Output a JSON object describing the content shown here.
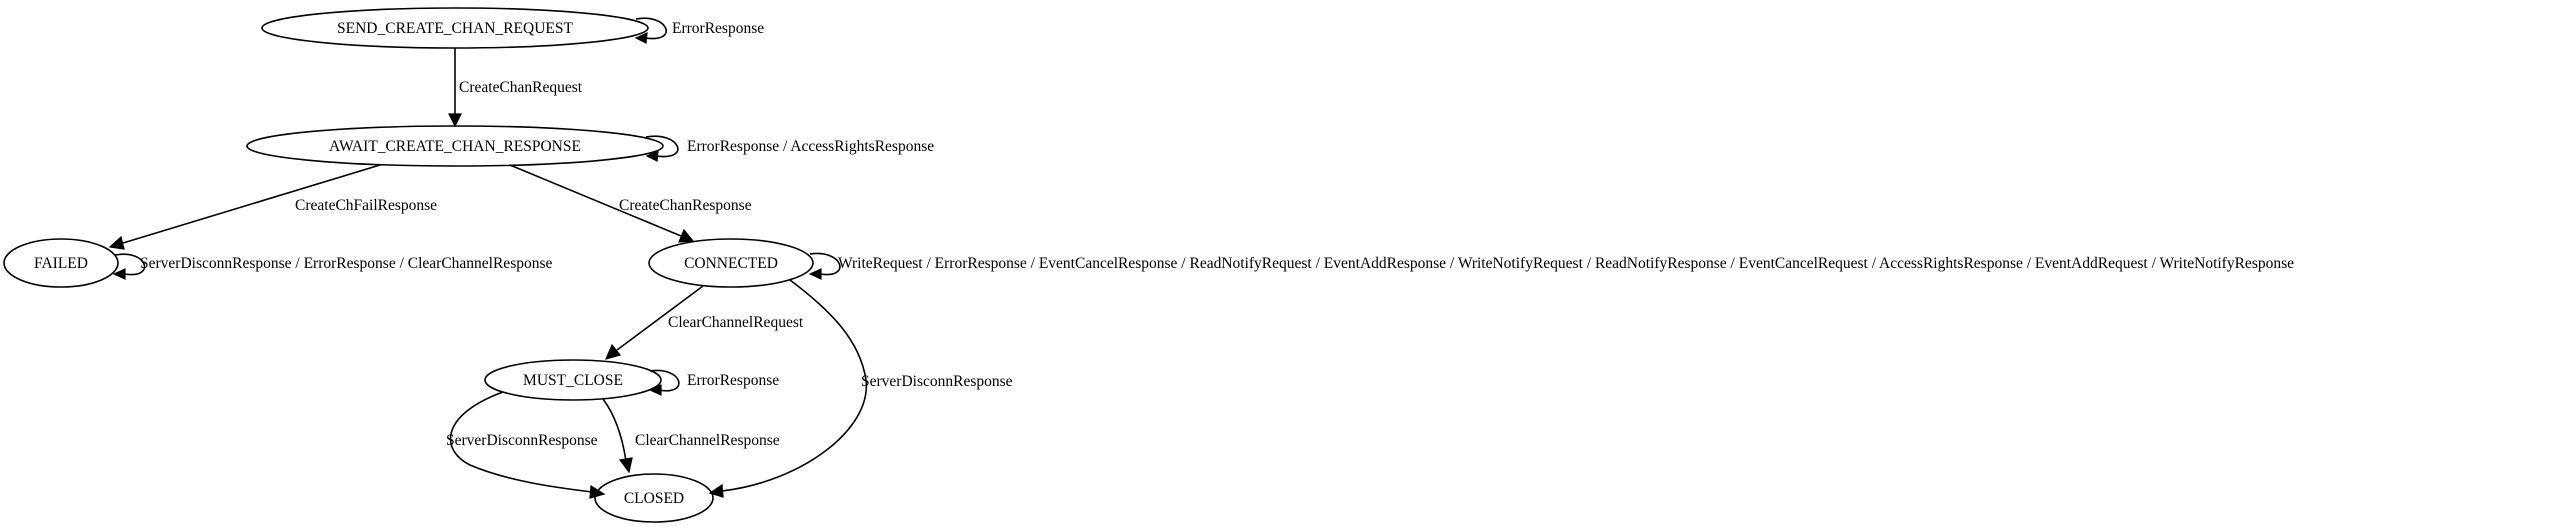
{
  "nodes": {
    "send_create_chan_request": "SEND_CREATE_CHAN_REQUEST",
    "await_create_chan_response": "AWAIT_CREATE_CHAN_RESPONSE",
    "failed": "FAILED",
    "connected": "CONNECTED",
    "must_close": "MUST_CLOSE",
    "closed": "CLOSED"
  },
  "edges": {
    "send_self": "ErrorResponse",
    "send_to_await": "CreateChanRequest",
    "await_self": "ErrorResponse / AccessRightsResponse",
    "await_to_failed": "CreateChFailResponse",
    "await_to_connected": "CreateChanResponse",
    "failed_self": "ServerDisconnResponse / ErrorResponse / ClearChannelResponse",
    "connected_self": "WriteRequest / ErrorResponse / EventCancelResponse / ReadNotifyRequest / EventAddResponse / WriteNotifyRequest / ReadNotifyResponse / EventCancelRequest / AccessRightsResponse / EventAddRequest / WriteNotifyResponse",
    "connected_to_must_close": "ClearChannelRequest",
    "connected_to_closed": "ServerDisconnResponse",
    "must_close_self": "ErrorResponse",
    "must_close_to_closed_left": "ServerDisconnResponse",
    "must_close_to_closed_right": "ClearChannelResponse"
  }
}
